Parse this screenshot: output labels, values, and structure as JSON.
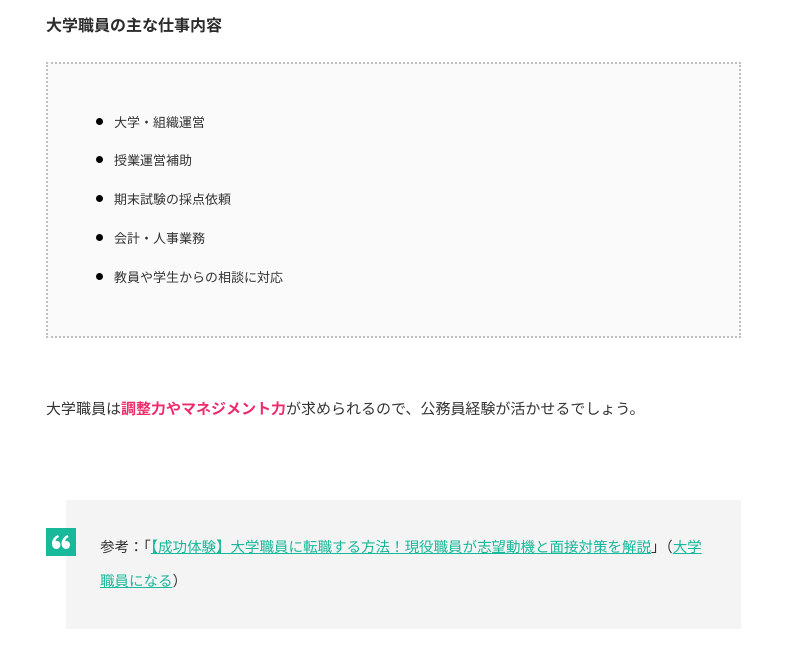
{
  "heading": "大学職員の主な仕事内容",
  "duties": [
    "大学・組織運営",
    "授業運営補助",
    "期末試験の採点依頼",
    "会計・人事業務",
    "教員や学生からの相談に対応"
  ],
  "paragraph": {
    "pre": "大学職員は",
    "highlight": "調整力やマネジメント力",
    "post": "が求められるので、公務員経験が活かせるでしょう。"
  },
  "reference": {
    "prefix": "参考：「",
    "link1_text": "【成功体験】大学職員に転職する方法！現役職員が志望動機と面接対策を解説",
    "mid": "」（",
    "link2_text": "大学職員になる",
    "suffix": "）"
  }
}
